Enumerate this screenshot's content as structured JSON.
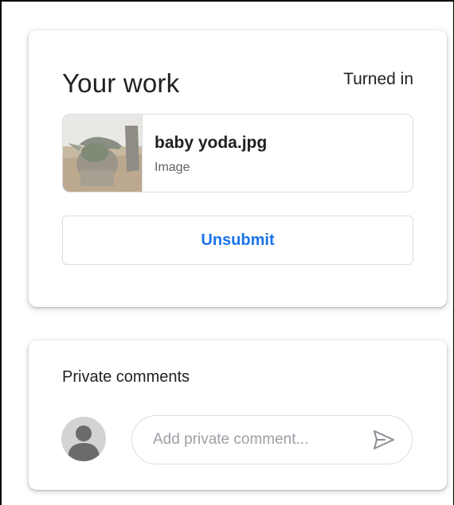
{
  "your_work": {
    "title": "Your work",
    "status": "Turned in",
    "attachment": {
      "name": "baby yoda.jpg",
      "type": "Image",
      "thumbnail_icon": "image-thumbnail"
    },
    "unsubmit_label": "Unsubmit"
  },
  "private_comments": {
    "title": "Private comments",
    "placeholder": "Add private comment...",
    "value": "",
    "avatar_icon": "person-avatar-icon",
    "send_icon": "send-icon"
  },
  "colors": {
    "accent": "#1a73e8",
    "text_primary": "#202124",
    "text_secondary": "#5f6368",
    "border": "#dadce0",
    "placeholder": "#9aa0a6"
  }
}
